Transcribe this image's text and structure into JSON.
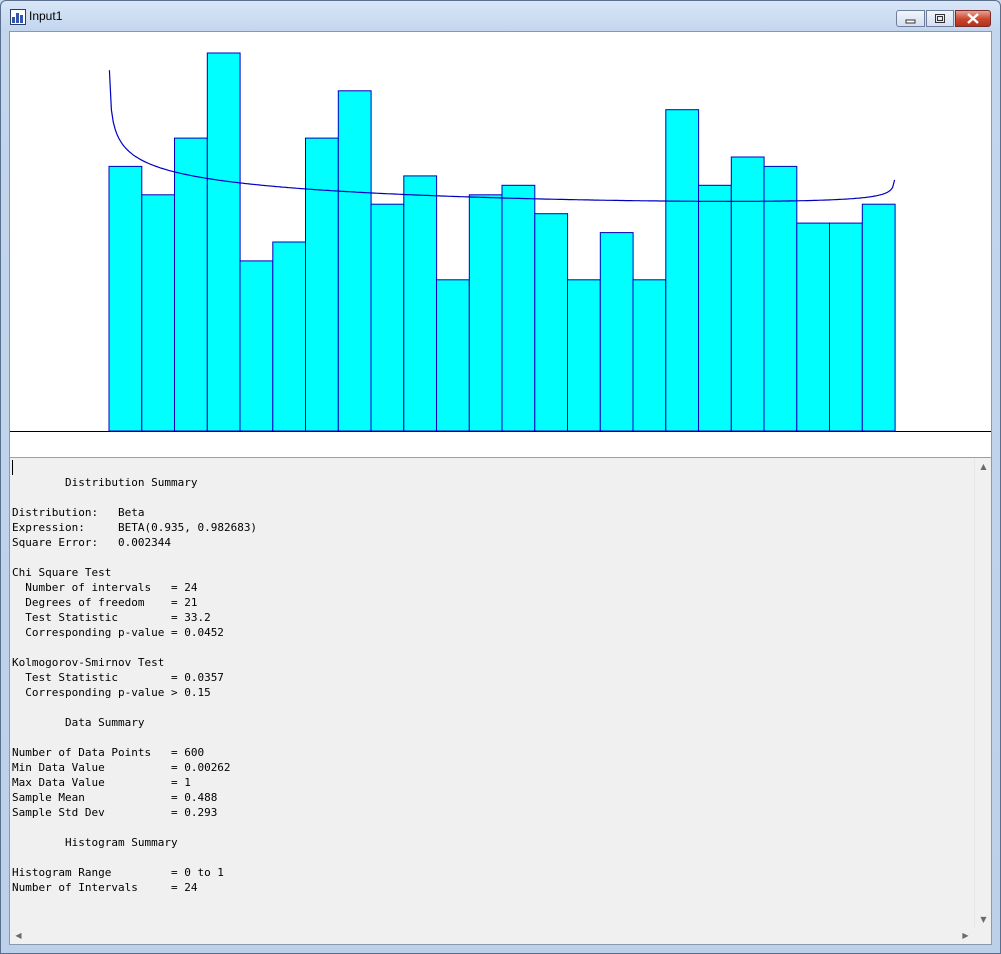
{
  "window": {
    "title": "Input1"
  },
  "colors": {
    "bar_fill": "#00ffff",
    "bar_stroke": "#0000c0",
    "curve": "#0000c0",
    "axis": "#000000"
  },
  "chart_data": {
    "type": "bar",
    "description_type": "histogram with fitted beta density curve",
    "bins": 24,
    "range": [
      0,
      1
    ],
    "values": [
      28,
      25,
      31,
      40,
      18,
      20,
      31,
      36,
      24,
      27,
      16,
      25,
      26,
      23,
      16,
      21,
      16,
      34,
      26,
      29,
      28,
      22,
      22,
      24
    ],
    "curve": {
      "label": "BETA(0.935, 0.982683)",
      "alpha": 0.935,
      "beta": 0.982683
    }
  },
  "summary": {
    "heading_distribution": "Distribution Summary",
    "distribution_label": "Distribution:",
    "distribution_value": "Beta",
    "expression_label": "Expression:",
    "expression_value": "BETA(0.935, 0.982683)",
    "square_error_label": "Square Error:",
    "square_error_value": "0.002344",
    "chi_heading": "Chi Square Test",
    "chi_intervals_label": "Number of intervals",
    "chi_intervals_value": "= 24",
    "chi_dof_label": "Degrees of freedom",
    "chi_dof_value": "= 21",
    "chi_stat_label": "Test Statistic",
    "chi_stat_value": "= 33.2",
    "chi_p_label": "Corresponding p-value",
    "chi_p_value": "= 0.0452",
    "ks_heading": "Kolmogorov-Smirnov Test",
    "ks_stat_label": "Test Statistic",
    "ks_stat_value": "= 0.0357",
    "ks_p_label": "Corresponding p-value",
    "ks_p_value": "> 0.15",
    "heading_data": "Data Summary",
    "points_label": "Number of Data Points",
    "points_value": "= 600",
    "min_label": "Min Data Value",
    "min_value": "= 0.00262",
    "max_label": "Max Data Value",
    "max_value": "= 1",
    "mean_label": "Sample Mean",
    "mean_value": "= 0.488",
    "std_label": "Sample Std Dev",
    "std_value": "= 0.293",
    "heading_hist": "Histogram Summary",
    "hist_range_label": "Histogram Range",
    "hist_range_value": "= 0 to 1",
    "hist_intervals_label": "Number of Intervals",
    "hist_intervals_value": "= 24"
  }
}
